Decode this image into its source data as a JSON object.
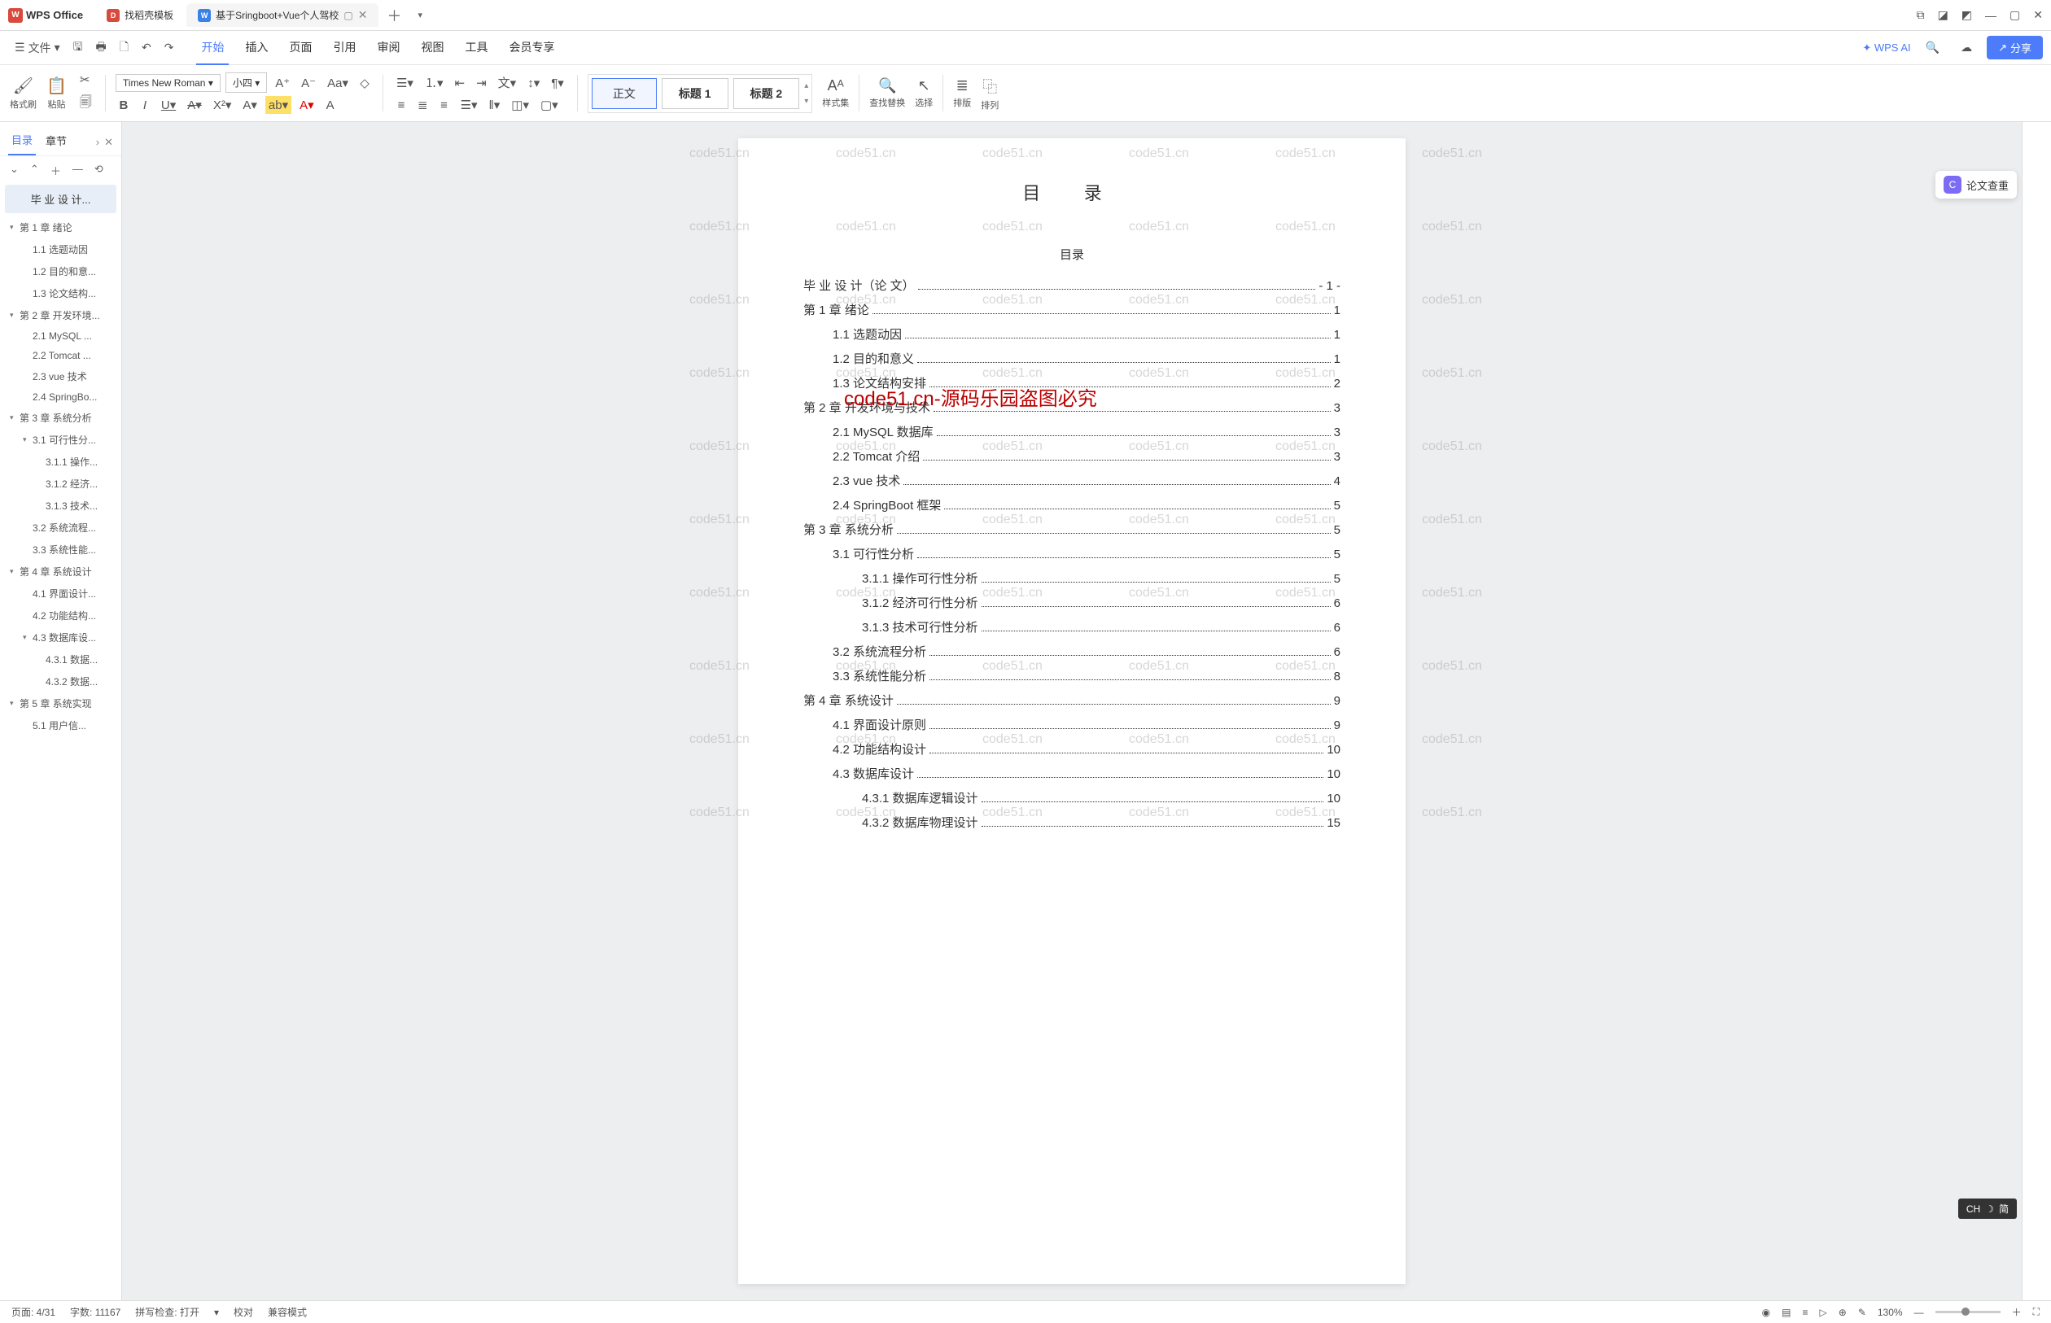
{
  "titlebar": {
    "app_name": "WPS Office",
    "tabs": [
      {
        "icon": "D",
        "icon_class": "red",
        "label": "找稻壳模板",
        "active": false
      },
      {
        "icon": "W",
        "icon_class": "blue",
        "label": "基于Sringboot+Vue个人驾校",
        "active": true
      }
    ]
  },
  "menubar": {
    "file": "文件",
    "items": [
      "开始",
      "插入",
      "页面",
      "引用",
      "审阅",
      "视图",
      "工具",
      "会员专享"
    ],
    "active_index": 0,
    "wps_ai": "WPS AI",
    "share": "分享"
  },
  "toolbar": {
    "format_painter": "格式刷",
    "paste": "粘贴",
    "font_name": "Times New Roman",
    "font_size": "小四",
    "styles": {
      "normal": "正文",
      "h1": "标题 1",
      "h2": "标题 2"
    },
    "style_set": "样式集",
    "find_replace": "查找替换",
    "select": "选择",
    "layout": "排版",
    "arrange": "排列"
  },
  "nav": {
    "tab_toc": "目录",
    "tab_chapter": "章节",
    "title": "毕 业 设 计...",
    "items": [
      {
        "level": 0,
        "caret": true,
        "text": "第 1 章 绪论"
      },
      {
        "level": 1,
        "caret": false,
        "text": "1.1 选题动因"
      },
      {
        "level": 1,
        "caret": false,
        "text": "1.2 目的和意..."
      },
      {
        "level": 1,
        "caret": false,
        "text": "1.3 论文结构..."
      },
      {
        "level": 0,
        "caret": true,
        "text": "第 2 章 开发环境..."
      },
      {
        "level": 1,
        "caret": false,
        "text": "2.1 MySQL ..."
      },
      {
        "level": 1,
        "caret": false,
        "text": "2.2 Tomcat ..."
      },
      {
        "level": 1,
        "caret": false,
        "text": "2.3 vue 技术"
      },
      {
        "level": 1,
        "caret": false,
        "text": "2.4 SpringBo..."
      },
      {
        "level": 0,
        "caret": true,
        "text": "第 3 章 系统分析"
      },
      {
        "level": 1,
        "caret": true,
        "text": "3.1 可行性分..."
      },
      {
        "level": 2,
        "caret": false,
        "text": "3.1.1 操作..."
      },
      {
        "level": 2,
        "caret": false,
        "text": "3.1.2 经济..."
      },
      {
        "level": 2,
        "caret": false,
        "text": "3.1.3 技术..."
      },
      {
        "level": 1,
        "caret": false,
        "text": "3.2 系统流程..."
      },
      {
        "level": 1,
        "caret": false,
        "text": "3.3 系统性能..."
      },
      {
        "level": 0,
        "caret": true,
        "text": "第 4 章 系统设计"
      },
      {
        "level": 1,
        "caret": false,
        "text": "4.1 界面设计..."
      },
      {
        "level": 1,
        "caret": false,
        "text": "4.2 功能结构..."
      },
      {
        "level": 1,
        "caret": true,
        "text": "4.3 数据库设..."
      },
      {
        "level": 2,
        "caret": false,
        "text": "4.3.1 数据..."
      },
      {
        "level": 2,
        "caret": false,
        "text": "4.3.2 数据..."
      },
      {
        "level": 0,
        "caret": true,
        "text": "第 5 章 系统实现"
      },
      {
        "level": 1,
        "caret": false,
        "text": "5.1 用户信..."
      }
    ]
  },
  "document": {
    "title": "目  录",
    "toc_heading": "目录",
    "toc": [
      {
        "indent": 0,
        "text": "毕 业 设 计（论 文）",
        "page": "- 1 -"
      },
      {
        "indent": 0,
        "text": "第 1 章  绪论",
        "page": "1"
      },
      {
        "indent": 1,
        "text": "1.1 选题动因",
        "page": "1"
      },
      {
        "indent": 1,
        "text": "1.2 目的和意义",
        "page": "1"
      },
      {
        "indent": 1,
        "text": "1.3 论文结构安排",
        "page": "2"
      },
      {
        "indent": 0,
        "text": "第 2 章  开发环境与技术",
        "page": "3"
      },
      {
        "indent": 1,
        "text": "2.1 MySQL 数据库",
        "page": "3"
      },
      {
        "indent": 1,
        "text": "2.2 Tomcat 介绍",
        "page": "3"
      },
      {
        "indent": 1,
        "text": "2.3 vue 技术",
        "page": "4"
      },
      {
        "indent": 1,
        "text": "2.4 SpringBoot 框架",
        "page": "5"
      },
      {
        "indent": 0,
        "text": "第 3 章  系统分析",
        "page": "5"
      },
      {
        "indent": 1,
        "text": "3.1 可行性分析",
        "page": "5"
      },
      {
        "indent": 2,
        "text": "3.1.1 操作可行性分析",
        "page": "5"
      },
      {
        "indent": 2,
        "text": "3.1.2 经济可行性分析",
        "page": "6"
      },
      {
        "indent": 2,
        "text": "3.1.3 技术可行性分析",
        "page": "6"
      },
      {
        "indent": 1,
        "text": "3.2 系统流程分析",
        "page": "6"
      },
      {
        "indent": 1,
        "text": "3.3 系统性能分析",
        "page": "8"
      },
      {
        "indent": 0,
        "text": "第 4 章  系统设计",
        "page": "9"
      },
      {
        "indent": 1,
        "text": "4.1 界面设计原则",
        "page": "9"
      },
      {
        "indent": 1,
        "text": "4.2 功能结构设计",
        "page": "10"
      },
      {
        "indent": 1,
        "text": "4.3 数据库设计",
        "page": "10"
      },
      {
        "indent": 2,
        "text": "4.3.1  数据库逻辑设计",
        "page": "10"
      },
      {
        "indent": 2,
        "text": "4.3.2  数据库物理设计",
        "page": "15"
      }
    ],
    "watermark_center": "code51.cn-源码乐园盗图必究",
    "watermark_tile": "code51.cn"
  },
  "floating": {
    "paper_check": "论文查重"
  },
  "ime": {
    "label": "CH",
    "mode": "简"
  },
  "status": {
    "page": "页面: 4/31",
    "words": "字数: 11167",
    "spell": "拼写检查: 打开",
    "proof": "校对",
    "compat": "兼容模式",
    "zoom": "130%"
  }
}
